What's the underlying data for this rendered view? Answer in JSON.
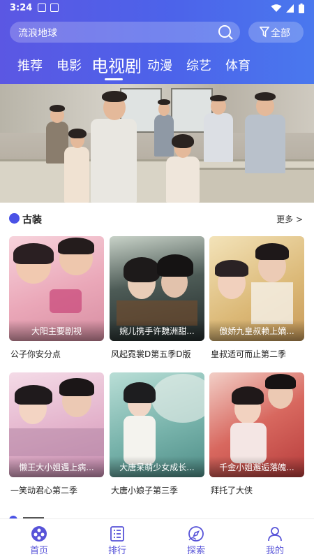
{
  "status_bar": {
    "time": "3:24"
  },
  "search": {
    "text": "流浪地球"
  },
  "filter": {
    "label": "全部"
  },
  "tabs": [
    {
      "label": "推荐",
      "active": false
    },
    {
      "label": "电影",
      "active": false
    },
    {
      "label": "电视剧",
      "active": true
    },
    {
      "label": "动漫",
      "active": false
    },
    {
      "label": "综艺",
      "active": false
    },
    {
      "label": "体育",
      "active": false
    }
  ],
  "section": {
    "title": "古装",
    "more": "更多 >"
  },
  "cards": [
    {
      "title": "公子你安分点",
      "caption": "大阳主要剧视",
      "poster_color": "#e9a9b6"
    },
    {
      "title": "风起霓裳D第五季D版",
      "caption": "婉儿携手许魏洲甜...",
      "poster_color": "#2f3b3a"
    },
    {
      "title": "皇叔适可而止第二季",
      "caption": "傲娇九皇叔赖上嫡...",
      "poster_color": "#d9b57c"
    },
    {
      "title": "一笑动君心第二季",
      "caption": "懒王大小姐遇上病...",
      "poster_color": "#d7a7c4"
    },
    {
      "title": "大唐小娘子第三季",
      "caption": "大唐呆萌少女成长...",
      "poster_color": "#6fa6a1"
    },
    {
      "title": "拜托了大侠",
      "caption": "千金小姐邂逅落魄...",
      "poster_color": "#c9494a"
    }
  ],
  "bottom_nav": [
    {
      "label": "首页",
      "icon": "home-film-icon"
    },
    {
      "label": "排行",
      "icon": "ranking-list-icon"
    },
    {
      "label": "探索",
      "icon": "explore-compass-icon"
    },
    {
      "label": "我的",
      "icon": "profile-icon"
    }
  ],
  "colors": {
    "accent": "#4a52e6",
    "nav_active": "#5753d8"
  }
}
